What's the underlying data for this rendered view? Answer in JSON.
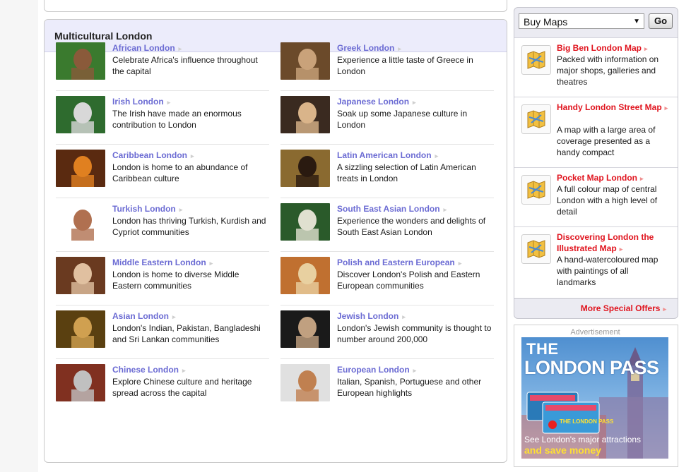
{
  "section": {
    "title": "Multicultural London"
  },
  "communities": [
    {
      "title": "African London",
      "desc": "Celebrate Africa's influence throughout the capital"
    },
    {
      "title": "Greek London",
      "desc": "Experience a little taste of Greece in London"
    },
    {
      "title": "Irish London",
      "desc": "The Irish have made an enormous contribution to London"
    },
    {
      "title": "Japanese London",
      "desc": "Soak up some Japanese culture in London"
    },
    {
      "title": "Caribbean London",
      "desc": "London is home to an abundance of Caribbean culture"
    },
    {
      "title": "Latin American London",
      "desc": "A sizzling selection of Latin American treats in London"
    },
    {
      "title": "Turkish London",
      "desc": "London has thriving Turkish, Kurdish and Cypriot communities"
    },
    {
      "title": "South East Asian London",
      "desc": "Experience the wonders and delights of South East Asian London"
    },
    {
      "title": "Middle Eastern London",
      "desc": "London is home to diverse Middle Eastern communities"
    },
    {
      "title": "Polish and Eastern European",
      "desc": "Discover London's Polish and Eastern European communities"
    },
    {
      "title": "Asian London",
      "desc": "London's Indian, Pakistan, Bangladeshi and Sri Lankan communities"
    },
    {
      "title": "Jewish London",
      "desc": "London's Jewish community is thought to number around 200,000"
    },
    {
      "title": "Chinese London",
      "desc": "Explore Chinese culture and heritage spread across the capital"
    },
    {
      "title": "European London",
      "desc": "Italian, Spanish, Portuguese and other European highlights"
    }
  ],
  "thumb_colors": [
    [
      "#3a7a2e",
      "#8a5a3a"
    ],
    [
      "#6b4a2a",
      "#c9a27a"
    ],
    [
      "#2e6b2e",
      "#d8d8d8"
    ],
    [
      "#3a2a20",
      "#d9b48a"
    ],
    [
      "#5a2a10",
      "#e08020"
    ],
    [
      "#8a6a30",
      "#2a1a10"
    ],
    [
      "#ffffff",
      "#b07050"
    ],
    [
      "#2a5a2a",
      "#e0e0d0"
    ],
    [
      "#6a3a20",
      "#e0c0a0"
    ],
    [
      "#c07030",
      "#e8d0a0"
    ],
    [
      "#5a4010",
      "#d0a050"
    ],
    [
      "#1a1a1a",
      "#c0a080"
    ],
    [
      "#803020",
      "#c0c0c0"
    ],
    [
      "#e0e0e0",
      "#c08050"
    ]
  ],
  "buy_maps": {
    "select_value": "Buy Maps",
    "go_label": "Go",
    "offers": [
      {
        "title": "Big Ben London Map",
        "desc": "Packed with information on major shops, galleries and theatres"
      },
      {
        "title": "Handy London Street Map",
        "desc": "A map with a large area of coverage presented as a handy compact"
      },
      {
        "title": "Pocket Map London",
        "desc": "A full colour map of central London with a high level of detail"
      },
      {
        "title": "Discovering London the Illustrated Map",
        "desc": "A hand-watercoloured map with paintings of all landmarks"
      }
    ],
    "more_label": "More Special Offers"
  },
  "advert": {
    "label": "Advertisement",
    "brand_line1": "THE",
    "brand_line2": "LONDON PASS",
    "tag_line1": "See London's major attractions",
    "tag_line2": "and save money",
    "card_text": "THE LONDON PASS"
  },
  "colors": {
    "link": "#6b6bd3",
    "offer_red": "#e0141e",
    "header_bg": "#ececfb"
  },
  "icons": {
    "arrow": "▸",
    "caret": "▼"
  }
}
